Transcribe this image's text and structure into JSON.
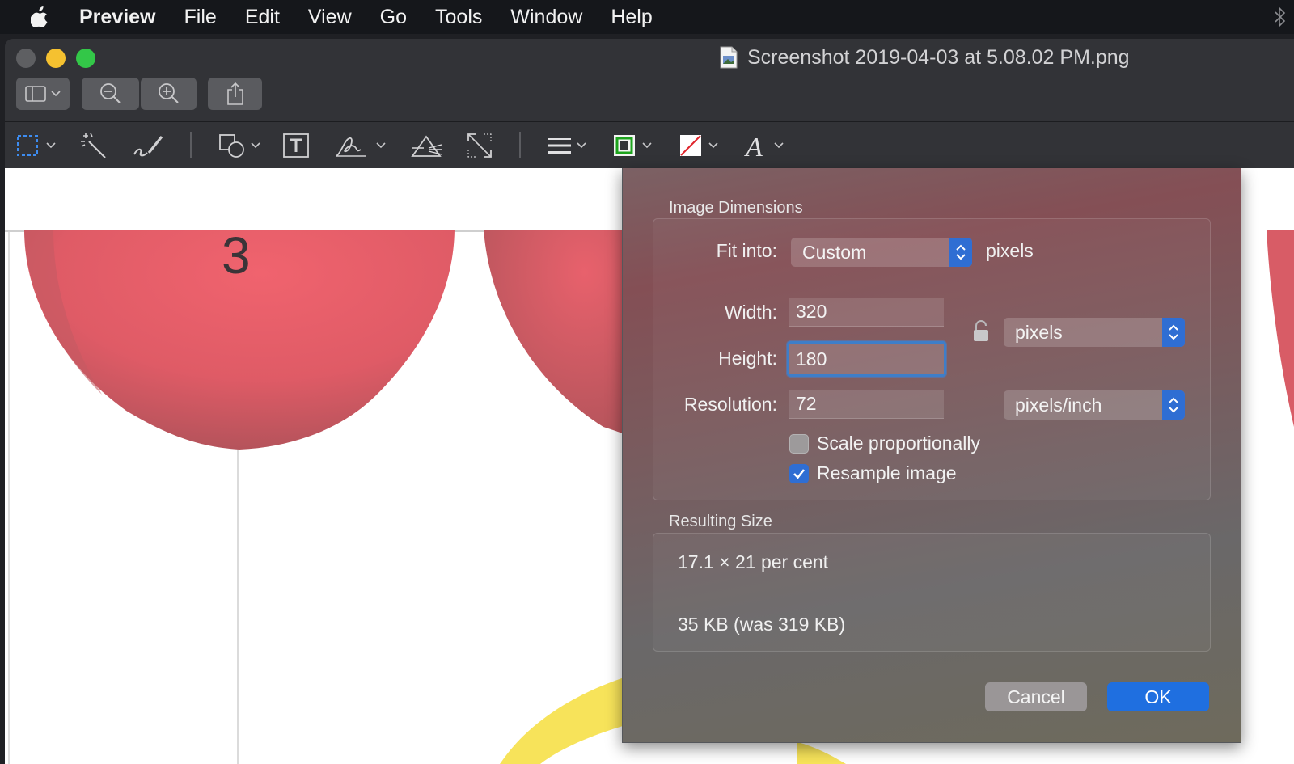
{
  "menubar": {
    "app_name": "Preview",
    "items": [
      "File",
      "Edit",
      "View",
      "Go",
      "Tools",
      "Window",
      "Help"
    ]
  },
  "window": {
    "title": "Screenshot 2019-04-03 at 5.08.02 PM.png"
  },
  "canvas": {
    "visible_digit": "3"
  },
  "dialog": {
    "image_dimensions_title": "Image Dimensions",
    "fit_into_label": "Fit into:",
    "fit_into_value": "Custom",
    "fit_into_unit": "pixels",
    "width_label": "Width:",
    "width_value": "320",
    "height_label": "Height:",
    "height_value": "180",
    "size_unit": "pixels",
    "resolution_label": "Resolution:",
    "resolution_value": "72",
    "resolution_unit": "pixels/inch",
    "scale_label": "Scale proportionally",
    "scale_checked": false,
    "resample_label": "Resample image",
    "resample_checked": true,
    "resulting_size_title": "Resulting Size",
    "result_percent": "17.1 × 21 per cent",
    "result_filesize": "35 KB (was 319 KB)",
    "cancel_label": "Cancel",
    "ok_label": "OK"
  },
  "colors": {
    "accent": "#1f6fe0",
    "menubar_bg": "#15171b",
    "toolbar_bg": "#323337",
    "balloon_red": "#e25b66",
    "close_light": "#5e5f62",
    "minimize_light": "#f5c130",
    "zoom_light": "#33c748"
  }
}
